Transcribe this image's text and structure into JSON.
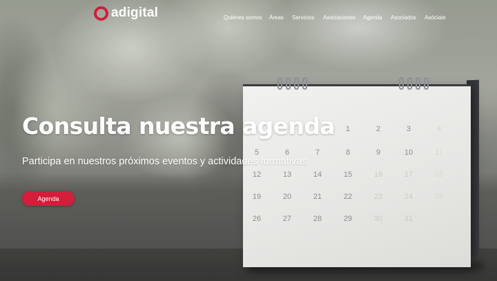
{
  "brand": {
    "name": "adigital",
    "accent_color": "#d21e3b"
  },
  "nav": {
    "items": [
      {
        "label": "Quiénes somos"
      },
      {
        "label": "Áreas"
      },
      {
        "label": "Servicios"
      },
      {
        "label": "Asociaciones"
      },
      {
        "label": "Agenda"
      },
      {
        "label": "Asociados"
      },
      {
        "label": "Asóciate"
      }
    ]
  },
  "hero": {
    "title": "Consulta nuestra agenda",
    "subtitle": "Participa en nuestros próximos eventos y actividades formativas",
    "button_label": "Agenda"
  },
  "calendar_photo": {
    "numbers": [
      "1",
      "2",
      "3",
      "4",
      "5",
      "6",
      "7",
      "8",
      "9",
      "10",
      "11",
      "12",
      "13",
      "14",
      "15",
      "16",
      "17",
      "18",
      "19",
      "20",
      "21",
      "22",
      "23",
      "24",
      "25",
      "26",
      "27",
      "28",
      "29",
      "30",
      "31"
    ]
  }
}
